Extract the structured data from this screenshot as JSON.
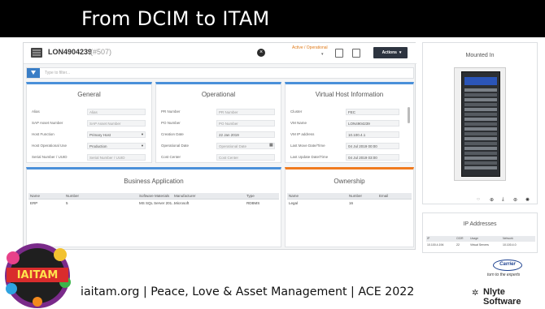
{
  "slide": {
    "title": "From DCIM to ITAM",
    "footer": "iaitam.org | Peace, Love & Asset Management | ACE 2022"
  },
  "logos": {
    "left_badge_text": "IAITAM",
    "carrier": "Carrier",
    "carrier_tagline": "turn to the experts",
    "nlyte": "Nlyte Software"
  },
  "asset": {
    "name": "LON4904239",
    "id": "(#507)",
    "status": "Active / Operational",
    "actions_label": "Actions",
    "filter_placeholder": "Type to filter..."
  },
  "general": {
    "title": "General",
    "fields": [
      {
        "label": "Alias",
        "value": "Alias"
      },
      {
        "label": "SAP Asset Number",
        "value": "SAP Asset Number"
      },
      {
        "label": "Host Function",
        "value": "Primary Host"
      },
      {
        "label": "Host Operational Use",
        "value": "Production"
      },
      {
        "label": "Serial Number / UUID",
        "value": "Serial Number / UUID"
      }
    ]
  },
  "operational": {
    "title": "Operational",
    "fields": [
      {
        "label": "PR Number",
        "value": "PR Number"
      },
      {
        "label": "PO Number",
        "value": "PO Number"
      },
      {
        "label": "Creation Date",
        "value": "22 Jan 2019"
      },
      {
        "label": "Operational Date",
        "value": "Operational Date"
      },
      {
        "label": "Cost Center",
        "value": "Cost Center"
      }
    ]
  },
  "virtual_host": {
    "title": "Virtual Host Information",
    "fields": [
      {
        "label": "Cluster",
        "value": "FEC"
      },
      {
        "label": "VM Name",
        "value": "LON4904239"
      },
      {
        "label": "VM IP address",
        "value": "10.100.4.1"
      },
      {
        "label": "Last Move Date/Time",
        "value": "04 Jul 2019 00:00"
      },
      {
        "label": "Last Update Date/Time",
        "value": "04 Jul 2019 03:00"
      }
    ]
  },
  "business_app": {
    "title": "Business Application",
    "columns": [
      "Name",
      "Number",
      "Software Materials",
      "Manufacturer",
      "Type"
    ],
    "rows": [
      [
        "ERP",
        "5",
        "MS SQL Server 201...",
        "Microsoft",
        "RDBMS"
      ]
    ]
  },
  "ownership": {
    "title": "Ownership",
    "columns": [
      "Name",
      "Number",
      "Email"
    ],
    "rows": [
      [
        "Legal",
        "16",
        ""
      ]
    ]
  },
  "mounted_in": {
    "title": "Mounted In"
  },
  "ip_addresses": {
    "title": "IP Addresses",
    "columns": [
      "IP",
      "CIDR",
      "Usage",
      "Network"
    ],
    "rows": [
      [
        "10.100.4.194",
        "22",
        "Virtual Servers",
        "10.100.4.0"
      ]
    ]
  },
  "colors": {
    "blue_accent": "#4a90d9",
    "orange_accent": "#f07b1f",
    "status_color": "#e07b1a"
  }
}
